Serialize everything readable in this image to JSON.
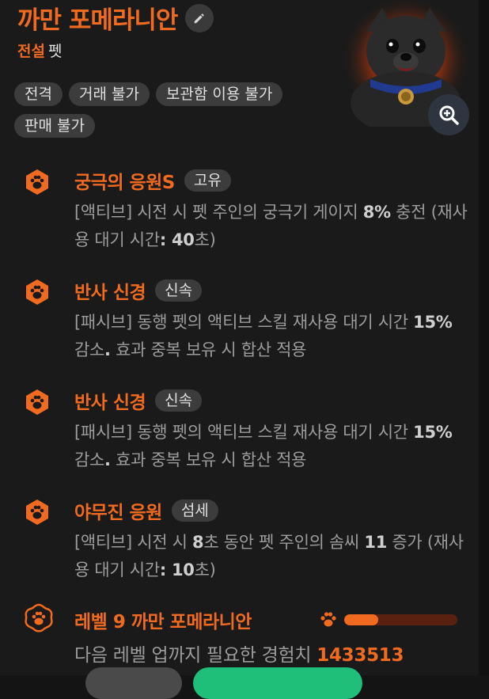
{
  "pet": {
    "name": "까만 포메라니안",
    "grade": "전설",
    "kind": "펫",
    "tags": [
      "전격",
      "거래 불가",
      "보관함 이용 불가",
      "판매 불가"
    ]
  },
  "skills": [
    {
      "name": "궁극의 응원S",
      "badge": "고유",
      "desc_parts": [
        {
          "t": "[액티브] 시전 시 펫 주인의 궁극기 게이지 ",
          "b": false
        },
        {
          "t": "8%",
          "b": true
        },
        {
          "t": " 충전 (재사용 대기 시간",
          "b": false
        },
        {
          "t": ": 40",
          "b": true
        },
        {
          "t": "초)",
          "b": false
        }
      ]
    },
    {
      "name": "반사 신경",
      "badge": "신속",
      "desc_parts": [
        {
          "t": "[패시브] 동행 펫의 액티브 스킬 재사용 대기 시간 ",
          "b": false
        },
        {
          "t": "15%",
          "b": true
        },
        {
          "t": " 감소",
          "b": false
        },
        {
          "t": ".",
          "b": true
        },
        {
          "t": " 효과 중복 보유 시 합산 적용",
          "b": false
        }
      ]
    },
    {
      "name": "반사 신경",
      "badge": "신속",
      "desc_parts": [
        {
          "t": "[패시브] 동행 펫의 액티브 스킬 재사용 대기 시간 ",
          "b": false
        },
        {
          "t": "15%",
          "b": true
        },
        {
          "t": " 감소",
          "b": false
        },
        {
          "t": ".",
          "b": true
        },
        {
          "t": " 효과 중복 보유 시 합산 적용",
          "b": false
        }
      ]
    },
    {
      "name": "야무진 응원",
      "badge": "섬세",
      "desc_parts": [
        {
          "t": "[액티브] 시전 시 ",
          "b": false
        },
        {
          "t": "8",
          "b": true
        },
        {
          "t": "초 동안 펫 주인의 솜씨 ",
          "b": false
        },
        {
          "t": "11",
          "b": true
        },
        {
          "t": " 증가 (재사용 대기 시간",
          "b": false
        },
        {
          "t": ": 10",
          "b": true
        },
        {
          "t": "초)",
          "b": false
        }
      ]
    }
  ],
  "level": {
    "name": "레벨 9 까만 포메라니안",
    "progress": 0.3,
    "exp_label": "다음 레벨 업까지 필요한 경험치 ",
    "exp_value": "1433513"
  },
  "colors": {
    "accent": "#f06a1f",
    "background": "#1a1a1a",
    "tag_bg": "#3c3c3c",
    "desc_text": "#9c9c9c",
    "confirm_button": "#1fbf7a"
  },
  "icons": {
    "edit": "pencil-icon",
    "zoom": "zoom-in-icon",
    "skill": "paw-icon",
    "level": "paw-badge-icon"
  }
}
